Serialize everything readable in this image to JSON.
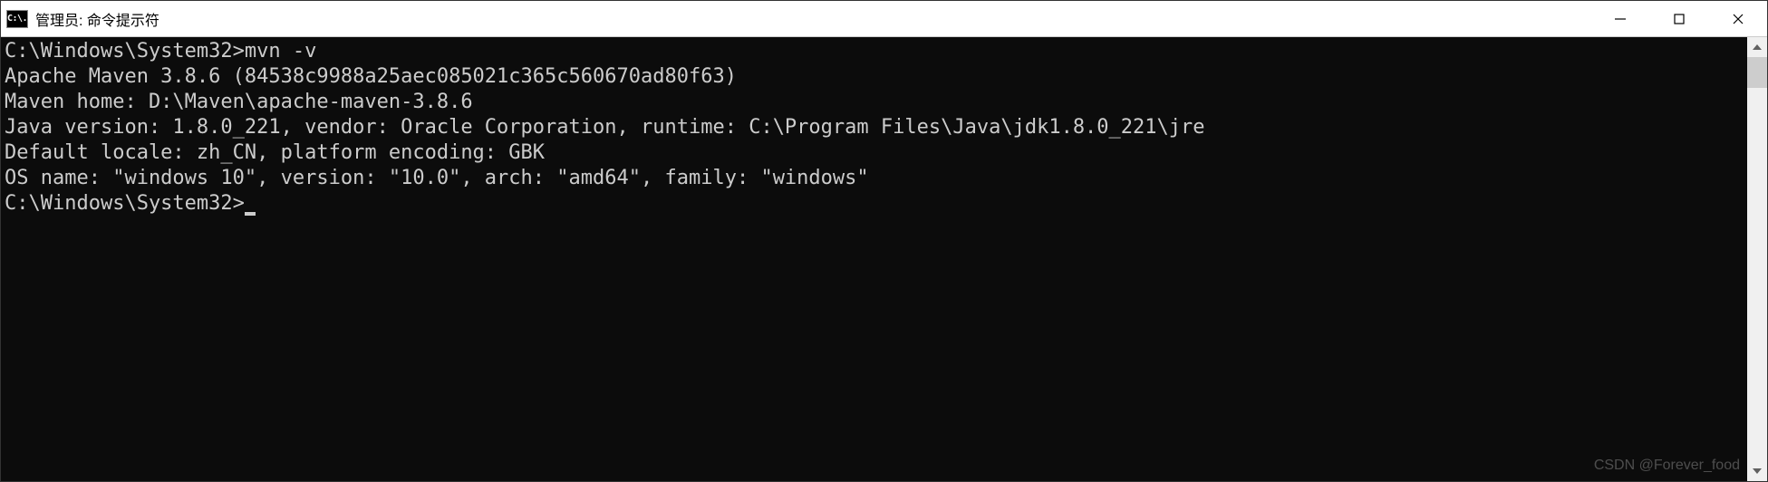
{
  "titlebar": {
    "icon_text": "C:\\.",
    "title": "管理员: 命令提示符"
  },
  "terminal": {
    "prompt1": "C:\\Windows\\System32>",
    "command1": "mvn -v",
    "output": {
      "line1": "Apache Maven 3.8.6 (84538c9988a25aec085021c365c560670ad80f63)",
      "line2": "Maven home: D:\\Maven\\apache-maven-3.8.6",
      "line3": "Java version: 1.8.0_221, vendor: Oracle Corporation, runtime: C:\\Program Files\\Java\\jdk1.8.0_221\\jre",
      "line4": "Default locale: zh_CN, platform encoding: GBK",
      "line5": "OS name: \"windows 10\", version: \"10.0\", arch: \"amd64\", family: \"windows\""
    },
    "blank": "",
    "prompt2": "C:\\Windows\\System32>"
  },
  "watermark": "CSDN @Forever_food"
}
